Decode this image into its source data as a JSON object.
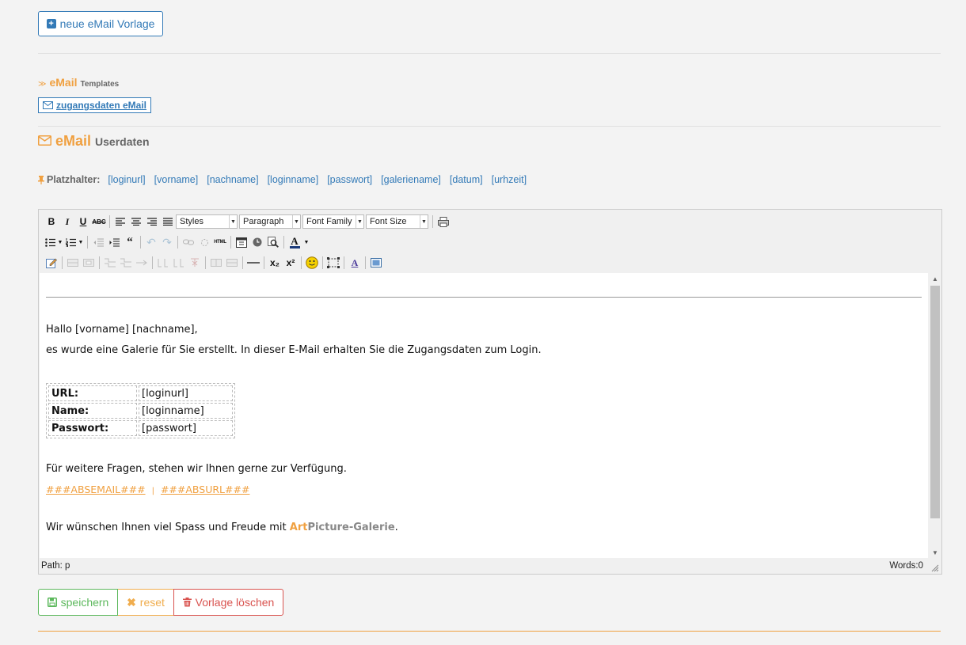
{
  "new_template_button": "neue eMail Vorlage",
  "templates_section": {
    "title": "eMail",
    "subtitle": "Templates"
  },
  "template_link": "zugangsdaten eMail",
  "userdata_section": {
    "title": "eMail",
    "subtitle": "Userdaten"
  },
  "placeholders": {
    "label": "Platzhalter:",
    "items": [
      "[loginurl]",
      "[vorname]",
      "[nachname]",
      "[loginname]",
      "[passwort]",
      "[galeriename]",
      "[datum]",
      "[urhzeit]"
    ]
  },
  "toolbar": {
    "styles": "Styles",
    "format": "Paragraph",
    "font_family": "Font Family",
    "font_size": "Font Size",
    "strike_label": "ABC",
    "html_label": "HTML",
    "bold": "B",
    "italic": "I",
    "underline": "U",
    "font_color": "A"
  },
  "content": {
    "greeting": "Hallo [vorname] [nachname],",
    "intro": "es wurde eine Galerie für Sie erstellt. In dieser E-Mail erhalten Sie die Zugangsdaten zum Login.",
    "table": [
      {
        "key": "URL:",
        "value": "[loginurl]"
      },
      {
        "key": "Name:",
        "value": "[loginname]"
      },
      {
        "key": "Passwort:",
        "value": "[passwort]"
      }
    ],
    "questions": "Für weitere Fragen, stehen wir Ihnen gerne zur Verfügung.",
    "abs_email": "###ABSEMAIL###",
    "separator": "|",
    "abs_url": "###ABSURL###",
    "closing_prefix": "Wir wünschen Ihnen viel Spass und Freude mit ",
    "brand_art": "Art",
    "brand_rest": "Picture-Galerie",
    "closing_suffix": "."
  },
  "status": {
    "path": "Path: p",
    "words": "Words:0"
  },
  "buttons": {
    "save": "speichern",
    "reset": "reset",
    "delete": "Vorlage löschen"
  },
  "colors": {
    "primary": "#337ab7",
    "orange": "#f0a040",
    "success": "#5cb85c",
    "warning": "#f0ad4e",
    "danger": "#d9534f"
  }
}
